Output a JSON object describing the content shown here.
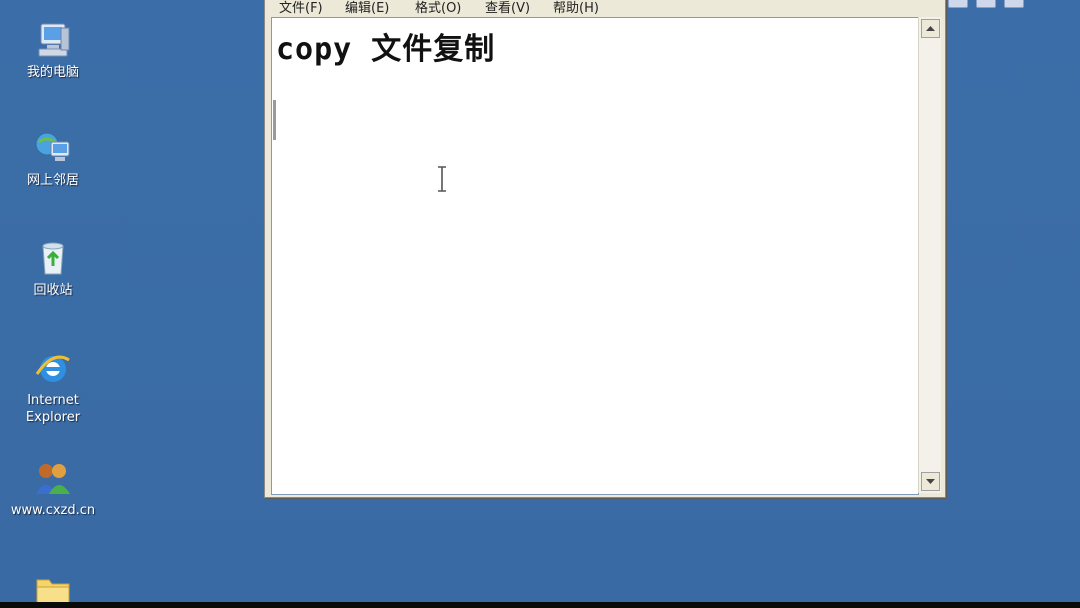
{
  "desktop": {
    "background_color": "#3a6ea5",
    "icons": [
      {
        "label": "我的电脑",
        "icon": "my-computer-icon"
      },
      {
        "label": "网上邻居",
        "icon": "network-places-icon"
      },
      {
        "label": "回收站",
        "icon": "recycle-bin-icon"
      },
      {
        "label_line1": "Internet",
        "label_line2": "Explorer",
        "icon": "internet-explorer-icon"
      },
      {
        "label": "www.cxzd.cn",
        "icon": "users-icon"
      },
      {
        "label": "",
        "icon": "folder-icon"
      }
    ]
  },
  "notepad": {
    "menu": [
      "文件(F)",
      "编辑(E)",
      "格式(O)",
      "查看(V)",
      "帮助(H)"
    ],
    "content": "copy 文件复制"
  }
}
